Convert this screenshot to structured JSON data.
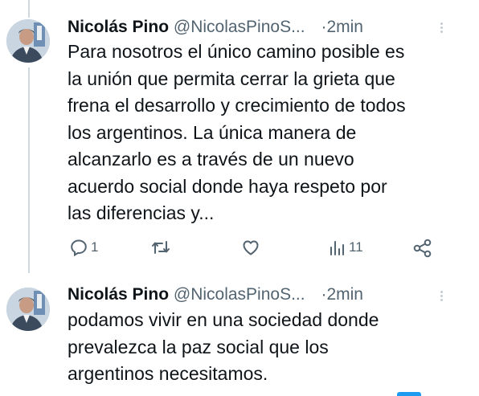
{
  "tweets": [
    {
      "author_name": "Nicolás Pino",
      "handle": "@NicolasPinoS...",
      "separator": "·",
      "time": "2min",
      "text": "Para nosotros el único camino posible es\nla unión que permita cerrar la grieta que\nfrena el desarrollo y crecimiento de todos\nlos argentinos. La única manera de\nalcanzarlo es a través de un nuevo\nacuerdo social donde haya respeto por\nlas diferencias y...",
      "actions": {
        "reply_count": "1",
        "views_count": "11"
      }
    },
    {
      "author_name": "Nicolás Pino",
      "handle": "@NicolasPinoS...",
      "separator": "·",
      "time": "2min",
      "text": "podamos vivir en una sociedad donde\nprevalezca la paz social que los\nargentinos necesitamos."
    }
  ],
  "icons": {
    "reply": "reply-icon",
    "retweet": "retweet-icon",
    "like": "heart-icon",
    "views": "views-icon",
    "share": "share-icon",
    "more": "more-vertical-icon"
  },
  "colors": {
    "text": "#0f1419",
    "secondary": "#536471",
    "thread_line": "#cfd9de",
    "accent": "#1d9bf0"
  }
}
